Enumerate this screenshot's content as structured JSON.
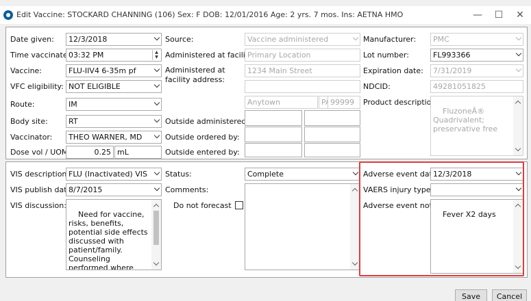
{
  "window": {
    "title": "Edit Vaccine: STOCKARD CHANNING (106)  Sex: F  DOB: 12/01/2016  Age: 2 yrs. 7 mos.  Ins: AETNA HMO",
    "minimize": "—",
    "maximize": "☐",
    "close": "✕"
  },
  "left": {
    "date_given": {
      "label": "Date given:",
      "value": "12/3/2018"
    },
    "time_vaccinated": {
      "label": "Time vaccinated:",
      "value": "03:32 PM"
    },
    "vaccine": {
      "label": "Vaccine:",
      "value": "FLU-IIV4 6-35m pf"
    },
    "vfc_eligibility": {
      "label": "VFC eligibility:",
      "value": "NOT ELIGIBLE"
    },
    "route": {
      "label": "Route:",
      "value": "IM"
    },
    "body_site": {
      "label": "Body site:",
      "value": "RT"
    },
    "vaccinator": {
      "label": "Vaccinator:",
      "value": "THEO WARNER, MD"
    },
    "dose": {
      "label": "Dose vol / UOM:",
      "value": "0.25",
      "uom": "mL"
    }
  },
  "middle": {
    "source": {
      "label": "Source:",
      "value": "Vaccine administered"
    },
    "administered_facility": {
      "label": "Administered at facility:",
      "value": "Primary Location"
    },
    "facility_address": {
      "label": "Administered at facility address:",
      "line1": "1234 Main Street",
      "line2": "",
      "city": "Anytown",
      "state": "PA",
      "zip": "99999"
    },
    "outside_administered": {
      "label": "Outside administered by:"
    },
    "outside_ordered": {
      "label": "Outside ordered by:"
    },
    "outside_entered": {
      "label": "Outside entered by:"
    }
  },
  "right": {
    "manufacturer": {
      "label": "Manufacturer:",
      "value": "PMC"
    },
    "lot_number": {
      "label": "Lot number:",
      "value": "FL993366"
    },
    "expiration": {
      "label": "Expiration date:",
      "value": "7/31/2019"
    },
    "ndcid": {
      "label": "NDCID:",
      "value": "49281051825"
    },
    "product_description": {
      "label": "Product description:",
      "value": "FluzoneÂ® Quadrivalent; preservative free"
    }
  },
  "vis": {
    "description": {
      "label": "VIS description:",
      "value": "FLU (Inactivated) VIS"
    },
    "publish_date": {
      "label": "VIS publish date:",
      "value": "8/7/2015"
    },
    "discussion": {
      "label": "VIS discussion:",
      "value": "Need for vaccine, risks, benefits, potential side effects\ndiscussed with patient/family.\nCounseling performed where"
    }
  },
  "status": {
    "status": {
      "label": "Status:",
      "value": "Complete"
    },
    "comments": {
      "label": "Comments:"
    },
    "do_not_forecast": {
      "label": "Do not forecast"
    }
  },
  "adverse": {
    "date": {
      "label": "Adverse event date:",
      "value": "12/3/2018"
    },
    "vaers": {
      "label": "VAERS injury type:",
      "value": ""
    },
    "notes": {
      "label": "Adverse event notes:",
      "value": "Fever X2 days"
    }
  },
  "footer": {
    "save": "Save",
    "cancel": "Cancel"
  },
  "colors": {
    "highlight": "#e03b3b",
    "logo": "#0d5f9e"
  }
}
